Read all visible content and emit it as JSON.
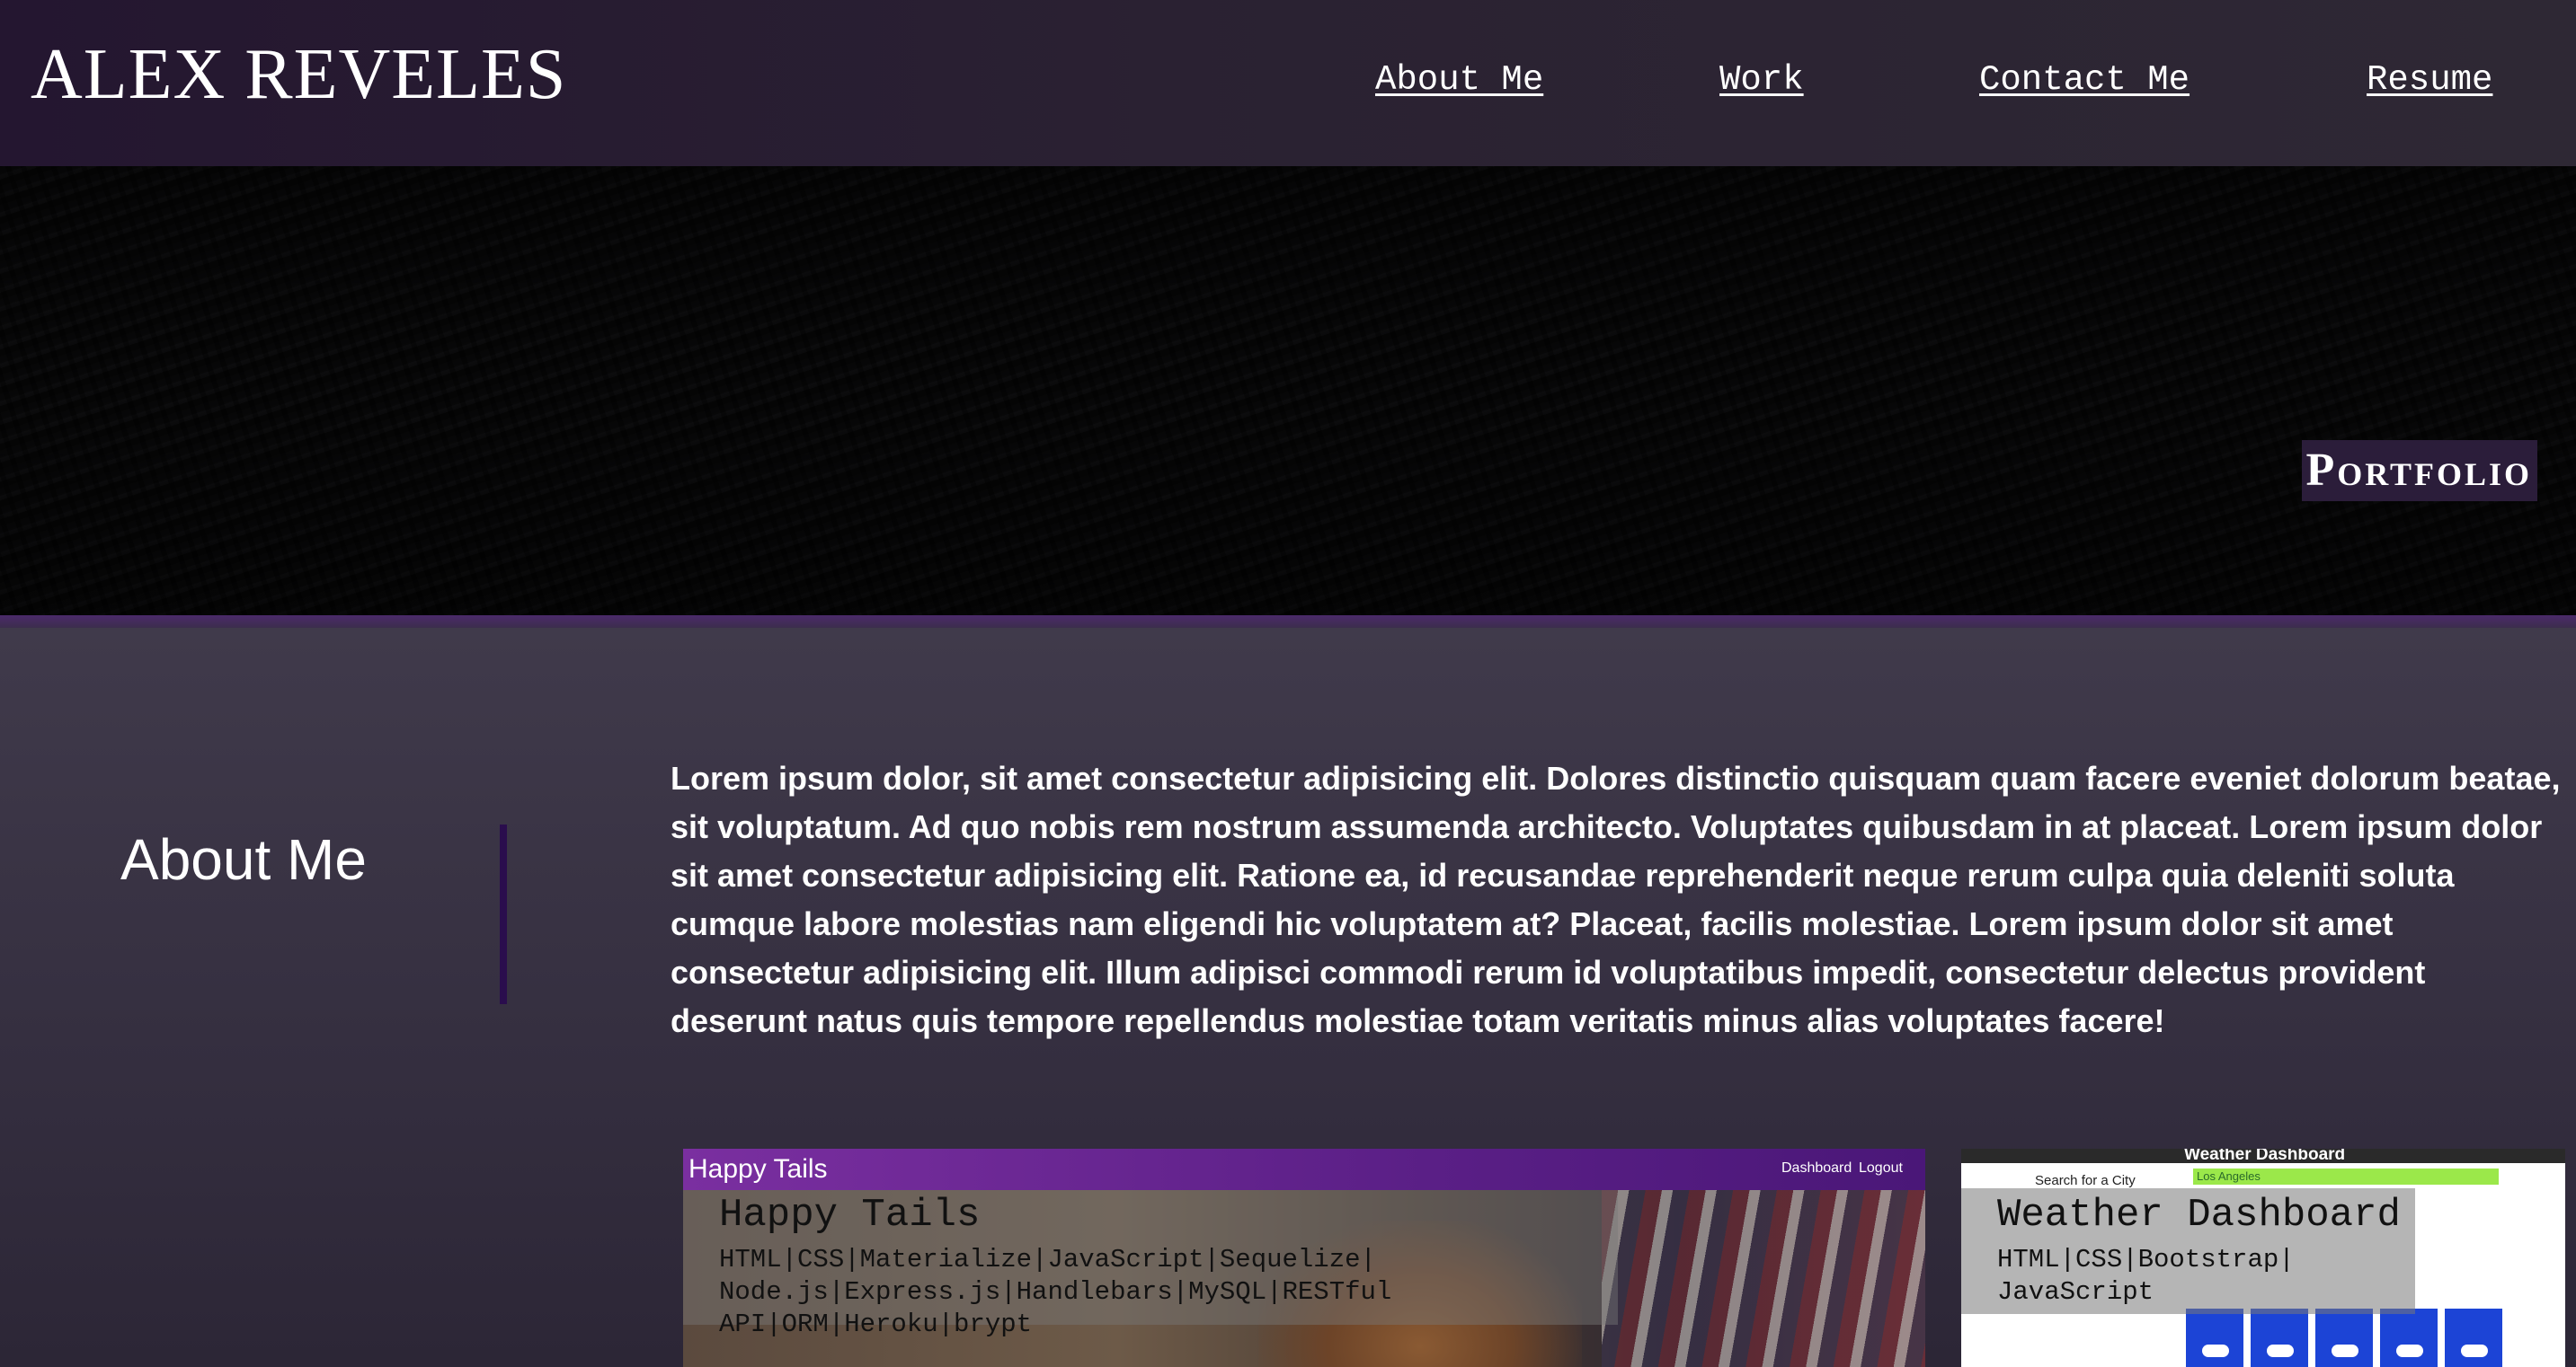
{
  "header": {
    "brand": "ALEX REVELES",
    "nav": [
      {
        "label": "About Me"
      },
      {
        "label": "Work"
      },
      {
        "label": "Contact Me"
      },
      {
        "label": "Resume"
      }
    ]
  },
  "hero": {
    "badge": "Portfolio"
  },
  "about": {
    "heading": "About Me",
    "body": "Lorem ipsum dolor, sit amet consectetur adipisicing elit. Dolores distinctio quisquam quam facere eveniet dolorum beatae, sit voluptatum. Ad quo nobis rem nostrum assumenda architecto. Voluptates quibusdam in at placeat. Lorem ipsum dolor sit amet consectetur adipisicing elit. Ratione ea, id recusandae reprehenderit neque rerum culpa quia deleniti soluta cumque labore molestias nam eligendi hic voluptatem at? Placeat, facilis molestiae. Lorem ipsum dolor sit amet consectetur adipisicing elit. Illum adipisci commodi rerum id voluptatibus impedit, consectetur delectus provident deserunt natus quis tempore repellendus molestiae totam veritatis minus alias voluptates facere!"
  },
  "projects": [
    {
      "title": "Happy Tails",
      "tech_lines": [
        "HTML|CSS|Materialize|JavaScript|Sequelize|",
        "Node.js|Express.js|Handlebars|MySQL|RESTful",
        "API|ORM|Heroku|brypt"
      ],
      "screenshot": {
        "app_title": "Happy Tails",
        "links": [
          "Dashboard",
          "Logout"
        ]
      }
    },
    {
      "title": "Weather Dashboard",
      "tech_lines": [
        "HTML|CSS|Bootstrap|",
        "JavaScript"
      ],
      "screenshot": {
        "app_title": "Weather Dashboard",
        "search_label": "Search for a City",
        "search_value": "Los Angeles"
      }
    }
  ],
  "colors": {
    "header_bg": "#241630",
    "accent_purple": "#4b2a6a",
    "divider": "#2a0d4d",
    "main_bg": "#3a3445"
  }
}
